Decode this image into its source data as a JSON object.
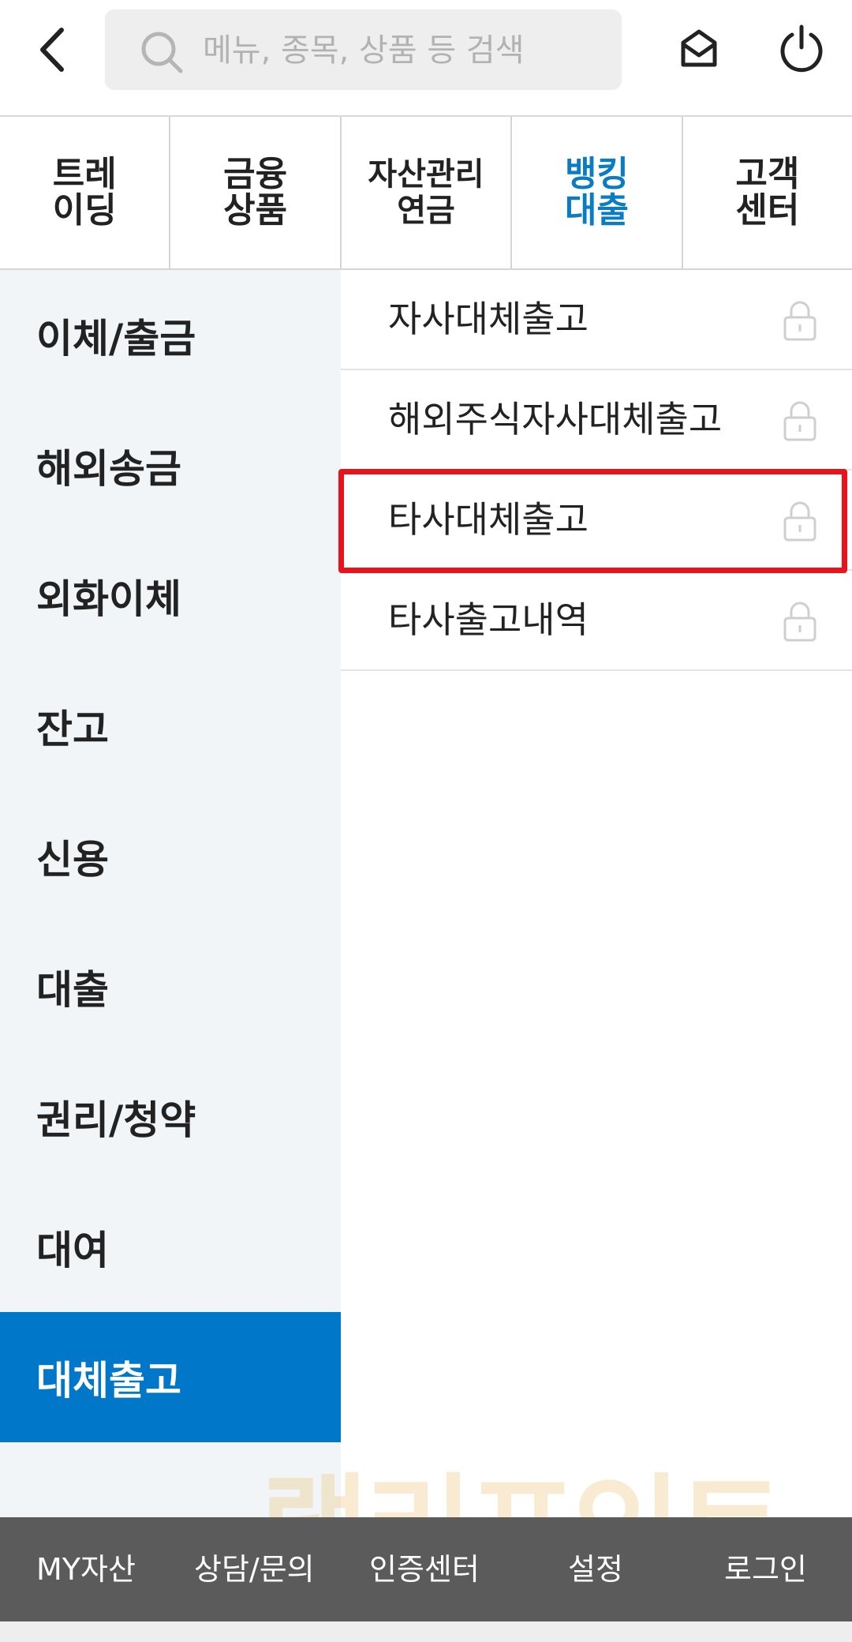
{
  "header": {
    "search_placeholder": "메뉴, 종목, 상품 등 검색",
    "icons": [
      "back-icon",
      "search-icon",
      "mail-icon",
      "power-icon"
    ]
  },
  "tabs": [
    {
      "label": "트레\n이딩",
      "active": false
    },
    {
      "label": "금융\n상품",
      "active": false
    },
    {
      "label": "자산관리\n연금",
      "active": false
    },
    {
      "label": "뱅킹\n대출",
      "active": true
    },
    {
      "label": "고객\n센터",
      "active": false
    }
  ],
  "left_menu": {
    "items": [
      {
        "label": "이체/출금"
      },
      {
        "label": "해외송금"
      },
      {
        "label": "외화이체"
      },
      {
        "label": "잔고"
      },
      {
        "label": "신용"
      },
      {
        "label": "대출"
      },
      {
        "label": "권리/청약"
      },
      {
        "label": "대여"
      },
      {
        "label": "대체출고",
        "active": true
      }
    ]
  },
  "right_menu": {
    "items": [
      {
        "label": "자사대체출고",
        "icon": "lock-icon"
      },
      {
        "label": "해외주식자사대체출고",
        "icon": "lock-icon"
      },
      {
        "label": "타사대체출고",
        "icon": "lock-icon",
        "highlighted": true
      },
      {
        "label": "타사출고내역",
        "icon": "lock-icon"
      }
    ]
  },
  "watermark": "랠리포인트",
  "bottom_bar": {
    "items": [
      "MY자산",
      "상담/문의",
      "인증센터",
      "설정",
      "로그인"
    ]
  },
  "colors": {
    "accent_blue": "#0077c8",
    "active_tab_text": "#0a7cc3",
    "highlight_red": "#e8141c",
    "left_menu_bg": "#f2f5f8",
    "bottom_bar_bg": "#5b5b5b"
  }
}
